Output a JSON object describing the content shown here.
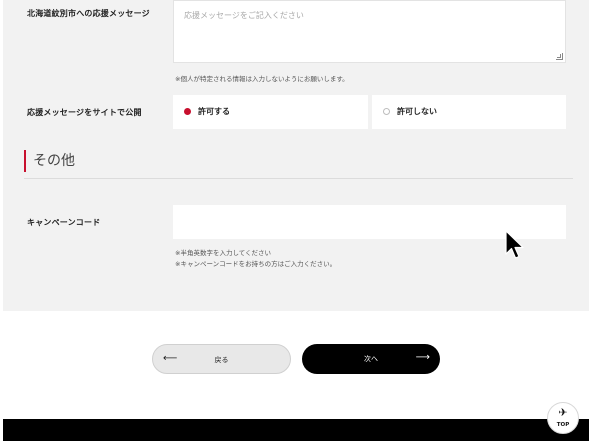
{
  "form": {
    "message": {
      "label": "北海道紋別市への応援メッセージ",
      "placeholder": "応援メッセージをご記入ください",
      "note": "※個人が特定される情報は入力しないようにお願いします。"
    },
    "publish": {
      "label": "応援メッセージをサイトで公開",
      "options": [
        {
          "label": "許可する",
          "selected": true
        },
        {
          "label": "許可しない",
          "selected": false
        }
      ]
    },
    "other_section": {
      "title": "その他"
    },
    "campaign": {
      "label": "キャンペーンコード",
      "value": "",
      "note1": "※半角英数字を入力してください",
      "note2": "※キャンペーンコードをお持ちの方はご入力ください。"
    }
  },
  "buttons": {
    "back_label": "戻る",
    "back_arrow": "⟵",
    "next_label": "次へ",
    "next_arrow": "⟶"
  },
  "top_button": {
    "label": "TOP",
    "icon": "airplane-icon"
  },
  "colors": {
    "accent": "#c8102e",
    "panel_bg": "#f2f2f2",
    "next_button_bg": "#000000"
  }
}
